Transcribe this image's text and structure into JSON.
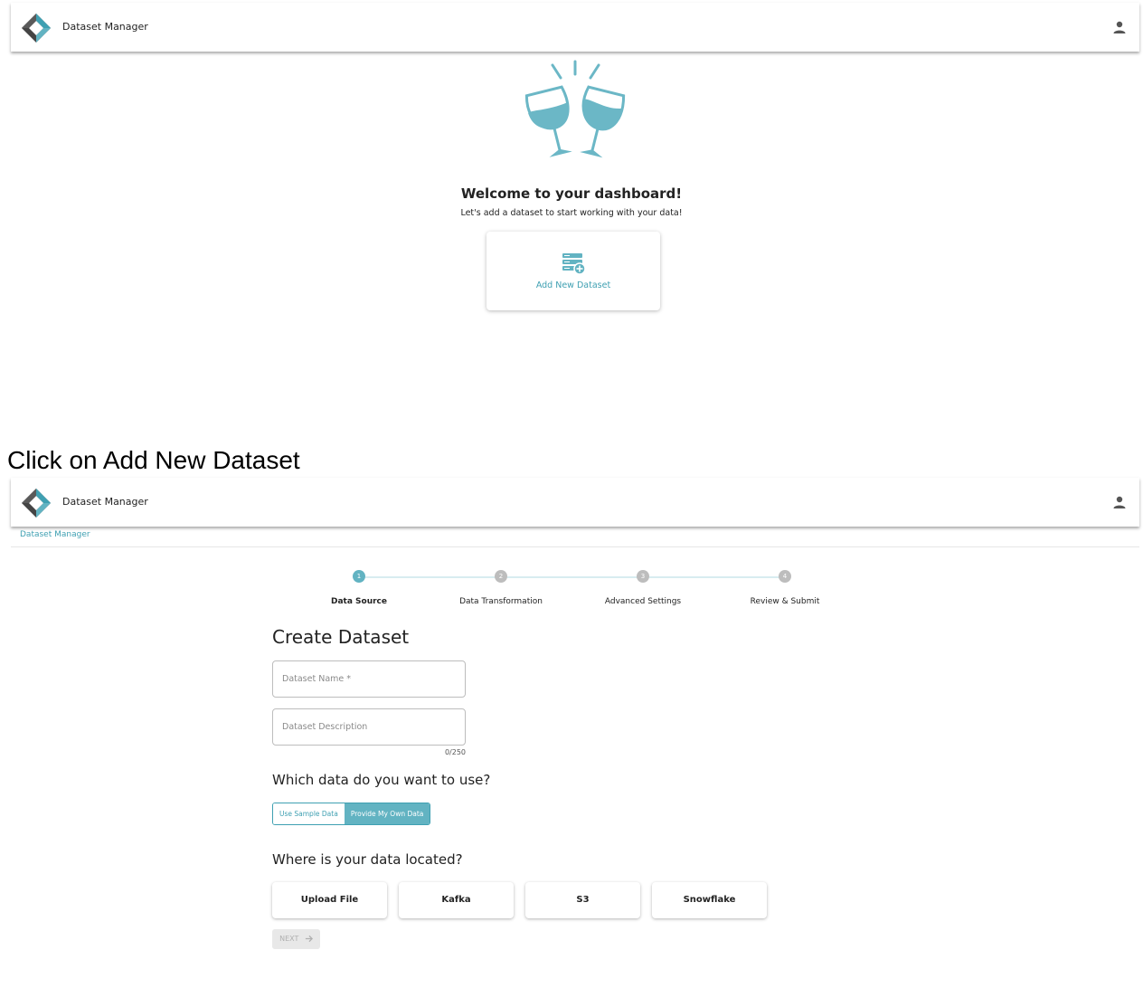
{
  "app": {
    "title": "Dataset Manager"
  },
  "welcome": {
    "title": "Welcome to your dashboard!",
    "subtitle": "Let's add a dataset to start working with your data!",
    "add_card_label": "Add New Dataset"
  },
  "instruction": "Click on Add New Dataset",
  "breadcrumb": "Dataset Manager",
  "stepper": {
    "steps": [
      {
        "number": "1",
        "label": "Data Source",
        "active": true
      },
      {
        "number": "2",
        "label": "Data Transformation",
        "active": false
      },
      {
        "number": "3",
        "label": "Advanced Settings",
        "active": false
      },
      {
        "number": "4",
        "label": "Review & Submit",
        "active": false
      }
    ]
  },
  "form": {
    "title": "Create Dataset",
    "name_placeholder": "Dataset Name *",
    "description_placeholder": "Dataset Description",
    "description_counter": "0/250",
    "data_question": "Which data do you want to use?",
    "data_options": [
      "Use Sample Data",
      "Provide My Own Data"
    ],
    "selected_data_option": "Provide My Own Data",
    "location_question": "Where is your data located?",
    "sources": [
      "Upload File",
      "Kafka",
      "S3",
      "Snowflake"
    ],
    "next_label": "NEXT"
  },
  "colors": {
    "accent": "#3fa0b2",
    "accent_fill": "#62b3c2",
    "inactive_step": "#bdbdbd"
  },
  "icons": {
    "logo": "app-logo-icon",
    "user": "user-icon",
    "illustration": "cheers-glasses-icon",
    "dataset": "dataset-add-icon",
    "next_arrow": "arrow-right-icon"
  }
}
